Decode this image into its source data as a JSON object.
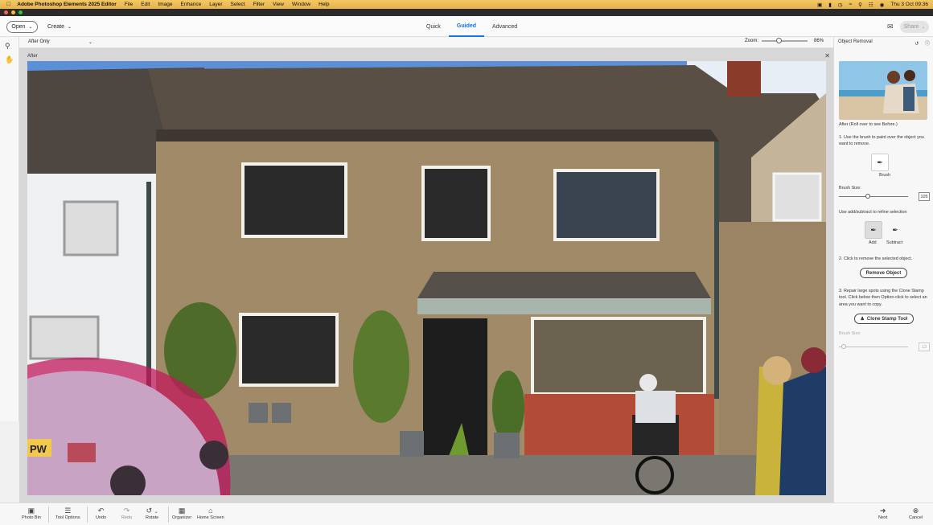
{
  "menubar": {
    "app_name": "Adobe Photoshop Elements 2025 Editor",
    "items": [
      "File",
      "Edit",
      "Image",
      "Enhance",
      "Layer",
      "Select",
      "Filter",
      "View",
      "Window",
      "Help"
    ],
    "clock": "Thu 3 Oct  09:36"
  },
  "topbar": {
    "open_label": "Open",
    "create_label": "Create",
    "modes": [
      "Quick",
      "Guided",
      "Advanced"
    ],
    "active_mode": "Guided",
    "share_label": "Share"
  },
  "options": {
    "view_value": "After Only",
    "zoom_label": "Zoom:",
    "zoom_value": "86%",
    "zoom_fraction": 0.35
  },
  "document": {
    "tab_label": "After"
  },
  "panel": {
    "title": "Object Removal",
    "caption": "After (Roll over to see Before.)",
    "step1": "1. Use the brush to paint over the object you want to remove.",
    "brush_label": "Brush",
    "brush_size_label": "Brush Size:",
    "brush_size_value": "105",
    "brush_size_fraction": 0.41,
    "refine_text": "Use add/subtract to refine selection",
    "add_label": "Add",
    "subtract_label": "Subtract",
    "step2": "2. Click to remove the selected object.",
    "remove_button": "Remove Object",
    "step3": "3. Repair large spots using the Clone Stamp tool. Click below then Option-click to select an area you want to copy.",
    "clone_button": "Clone Stamp Tool",
    "clone_size_label": "Brush Size:",
    "clone_size_value": "13",
    "clone_size_fraction": 0.04
  },
  "bottombar": {
    "photo_bin": "Photo Bin",
    "tool_options": "Tool Options",
    "undo": "Undo",
    "redo": "Redo",
    "rotate": "Rotate",
    "organizer": "Organizer",
    "home_screen": "Home Screen",
    "next": "Next",
    "cancel": "Cancel"
  },
  "photo": {
    "plate_text": "PW"
  },
  "colors": {
    "accent": "#1473e6",
    "selection_overlay": "#c2185b"
  }
}
